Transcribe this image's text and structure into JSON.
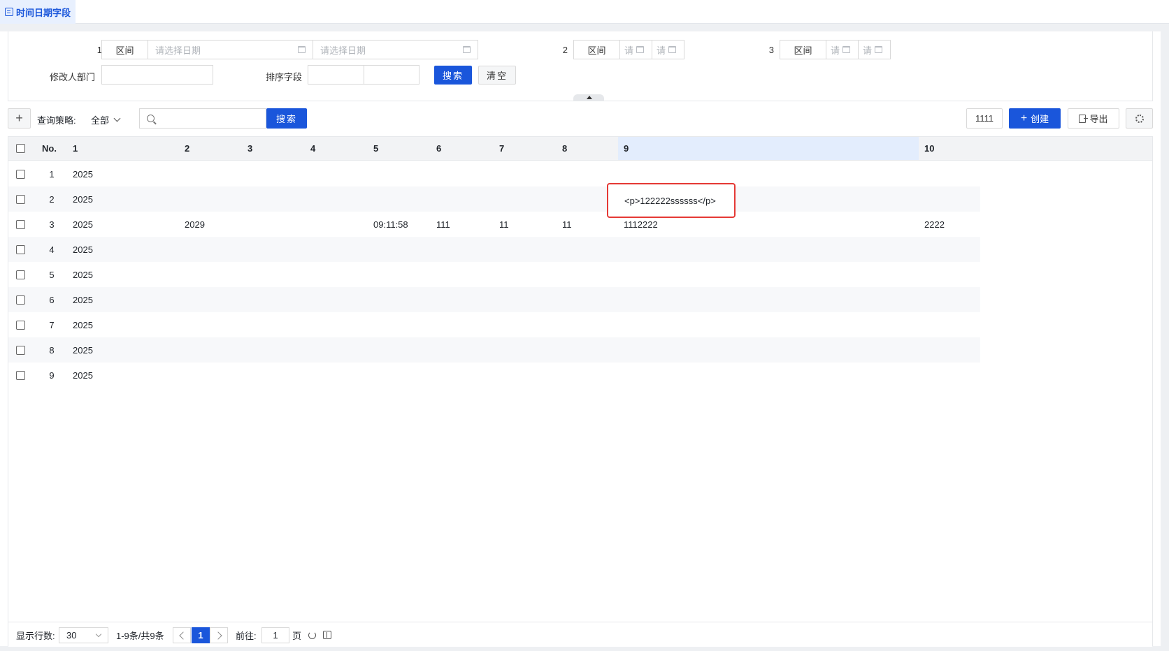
{
  "tab": {
    "title": "时间日期字段"
  },
  "filters": {
    "row1": [
      {
        "label": "1",
        "mode": "区间",
        "start_placeholder": "请选择日期",
        "end_placeholder": "请选择日期"
      },
      {
        "label": "2",
        "mode": "区间",
        "start_placeholder": "请",
        "end_placeholder": "请"
      },
      {
        "label": "3",
        "mode": "区间",
        "start_placeholder": "请",
        "end_placeholder": "请"
      }
    ],
    "dept_label": "修改人部门",
    "dept_value": "",
    "sort_label": "排序字段",
    "search_btn": "搜索",
    "clear_btn": "清空"
  },
  "toolbar": {
    "add": "+",
    "strategy_label": "查询策略:",
    "strategy_value": "全部",
    "search_btn": "搜索",
    "search_value": "",
    "btn_1111": "1111",
    "create_btn": "创建",
    "create_prefix": "+",
    "export_btn": "导出"
  },
  "table": {
    "columns": [
      "No.",
      "1",
      "2",
      "3",
      "4",
      "5",
      "6",
      "7",
      "8",
      "9",
      "10"
    ],
    "rows": [
      {
        "no": "1",
        "c1": "2025",
        "c2": "",
        "c5": "",
        "c6": "",
        "c7": "",
        "c8": "",
        "c9": "",
        "c10": ""
      },
      {
        "no": "2",
        "c1": "2025",
        "c2": "",
        "c5": "",
        "c6": "",
        "c7": "",
        "c8": "",
        "c9": "",
        "c10": ""
      },
      {
        "no": "3",
        "c1": "2025",
        "c2": "2029",
        "c5": "09:11:58",
        "c6": "111",
        "c7": "11",
        "c8": "11",
        "c9": "1112222",
        "c10": "2222"
      },
      {
        "no": "4",
        "c1": "2025",
        "c2": "",
        "c5": "",
        "c6": "",
        "c7": "",
        "c8": "",
        "c9": "",
        "c10": ""
      },
      {
        "no": "5",
        "c1": "2025",
        "c2": "",
        "c5": "",
        "c6": "",
        "c7": "",
        "c8": "",
        "c9": "",
        "c10": ""
      },
      {
        "no": "6",
        "c1": "2025",
        "c2": "",
        "c5": "",
        "c6": "",
        "c7": "",
        "c8": "",
        "c9": "",
        "c10": ""
      },
      {
        "no": "7",
        "c1": "2025",
        "c2": "",
        "c5": "",
        "c6": "",
        "c7": "",
        "c8": "",
        "c9": "",
        "c10": ""
      },
      {
        "no": "8",
        "c1": "2025",
        "c2": "",
        "c5": "",
        "c6": "",
        "c7": "",
        "c8": "",
        "c9": "",
        "c10": ""
      },
      {
        "no": "9",
        "c1": "2025",
        "c2": "",
        "c5": "",
        "c6": "",
        "c7": "",
        "c8": "",
        "c9": "",
        "c10": ""
      }
    ],
    "tooltip": "<p>122222ssssss</p>"
  },
  "footer": {
    "rows_label": "显示行数:",
    "rows_value": "30",
    "range_text": "1-9条/共9条",
    "current_page": "1",
    "goto_label": "前往:",
    "goto_value": "1",
    "page_unit": "页"
  },
  "colors": {
    "primary": "#1a56db",
    "highlight_col": "#e3edfd",
    "tooltip_border": "#e53935"
  }
}
